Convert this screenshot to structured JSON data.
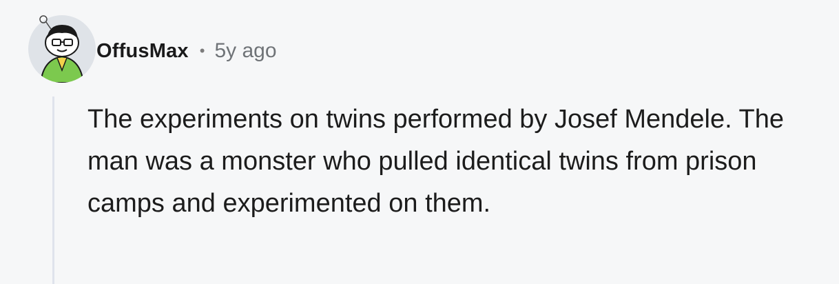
{
  "comment": {
    "author": "OffusMax",
    "separator": "•",
    "age": "5y ago",
    "avatar_icon": "snoo-avatar-icon",
    "body": "The experiments on twins performed by Josef Mendele. The man was a monster who pulled identical twins from prison camps and experimented on them."
  },
  "colors": {
    "background": "#f6f7f8",
    "thread_line": "#dfe3ec",
    "username": "#1a1a1b",
    "meta": "#6f7377",
    "body": "#1c1c1c",
    "avatar_bg": "#dfe3e8",
    "avatar_shirt": "#7cc94e"
  }
}
